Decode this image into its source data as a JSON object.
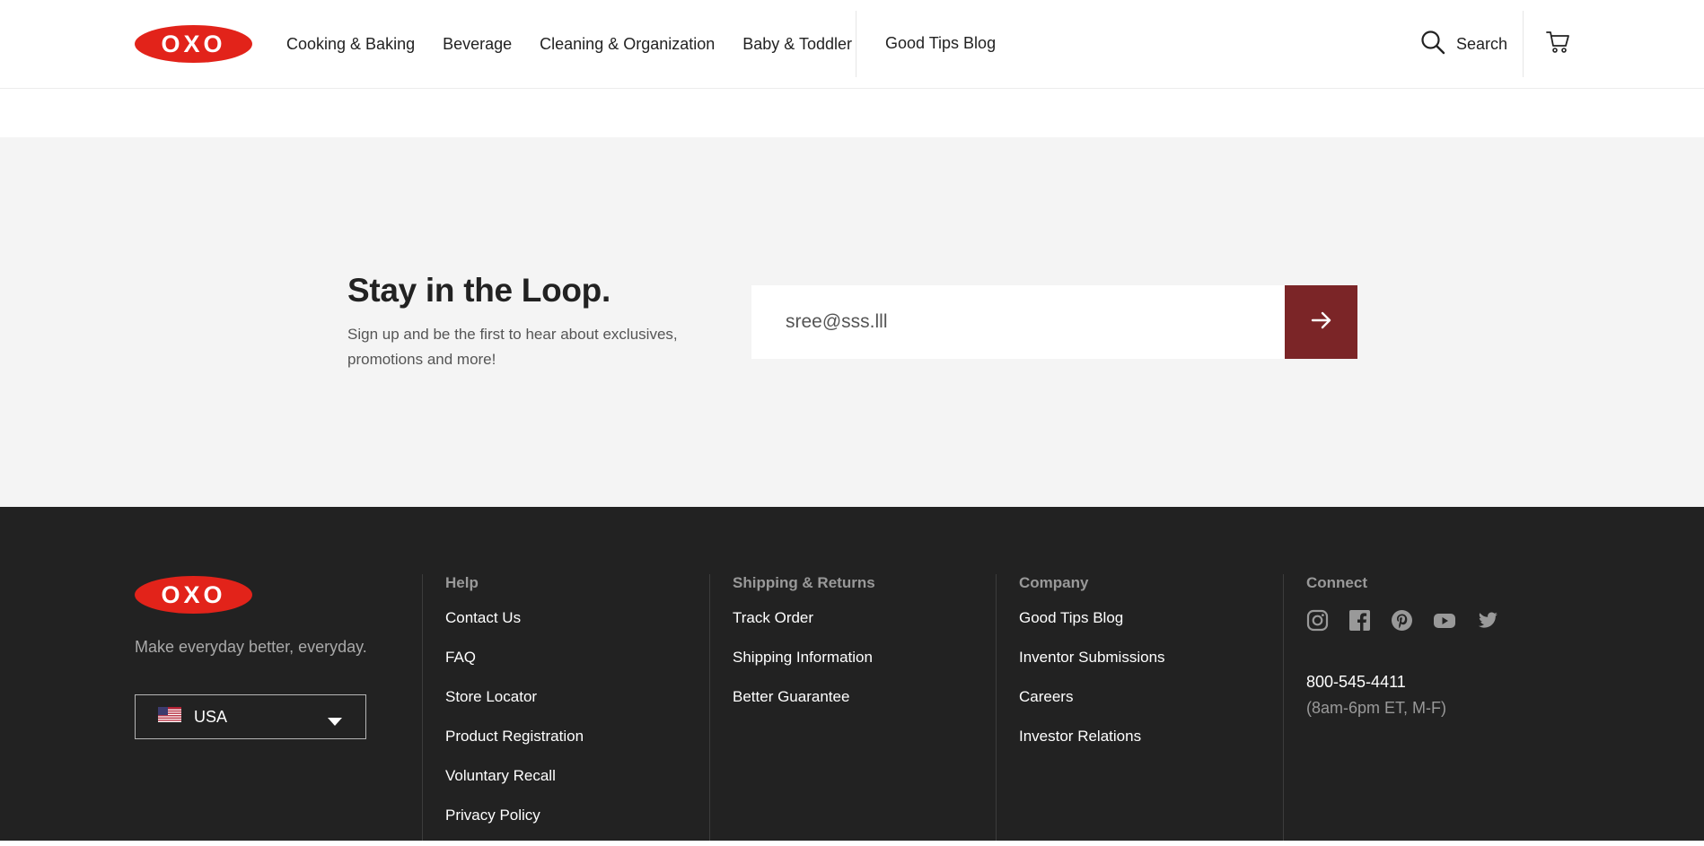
{
  "brand": {
    "logo_text": "OXO",
    "red": "#e2231a",
    "submit_color": "#7b2527",
    "footer_bg": "#222222",
    "newsletter_bg": "#f4f4f4"
  },
  "header": {
    "nav": [
      "Cooking & Baking",
      "Beverage",
      "Cleaning & Organization",
      "Baby & Toddler"
    ],
    "blog": "Good Tips Blog",
    "search_label": "Search",
    "search_icon": "search-icon",
    "cart_icon": "cart-icon"
  },
  "newsletter": {
    "title": "Stay in the Loop.",
    "subtitle": "Sign up and be the first to hear about exclusives, promotions and more!",
    "email_value": "sree@sss.lll",
    "submit_icon": "arrow-right-icon"
  },
  "footer": {
    "tagline": "Make everyday better, everyday.",
    "country": "USA",
    "country_icon": "us-flag-icon",
    "columns": [
      {
        "heading": "Help",
        "links": [
          "Contact Us",
          "FAQ",
          "Store Locator",
          "Product Registration",
          "Voluntary Recall",
          "Privacy Policy"
        ]
      },
      {
        "heading": "Shipping & Returns",
        "links": [
          "Track Order",
          "Shipping Information",
          "Better Guarantee"
        ]
      },
      {
        "heading": "Company",
        "links": [
          "Good Tips Blog",
          "Inventor Submissions",
          "Careers",
          "Investor Relations"
        ]
      }
    ],
    "connect": {
      "heading": "Connect",
      "social": [
        "instagram-icon",
        "facebook-icon",
        "pinterest-icon",
        "youtube-icon",
        "twitter-icon"
      ],
      "phone": "800-545-4411",
      "hours": "(8am-6pm ET, M-F)"
    }
  }
}
